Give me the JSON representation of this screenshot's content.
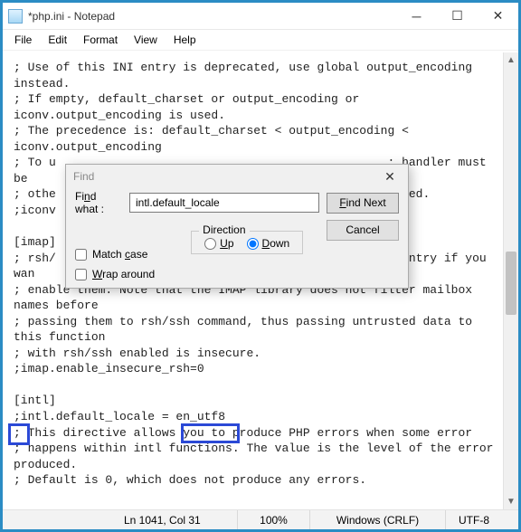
{
  "window": {
    "title": "*php.ini - Notepad"
  },
  "menu": {
    "file": "File",
    "edit": "Edit",
    "format": "Format",
    "view": "View",
    "help": "Help"
  },
  "editor": {
    "text": "; Use of this INI entry is deprecated, use global output_encoding instead.\n; If empty, default_charset or output_encoding or iconv.output_encoding is used.\n; The precedence is: default_charset < output_encoding < iconv.output_encoding\n; To u                                               : handler must be\n; othe                                               ormed.\n;iconv\n\n[imap]\n; rsh/                                               : entry if you wan\n; enable them. Note that the IMAP library does not filter mailbox names before\n; passing them to rsh/ssh command, thus passing untrusted data to this function\n; with rsh/ssh enabled is insecure.\n;imap.enable_insecure_rsh=0\n\n[intl]\n;intl.default_locale = en_utf8\n; This directive allows you to produce PHP errors when some error\n; happens within intl functions. The value is the level of the error produced.\n; Default is 0, which does not produce any errors."
  },
  "find": {
    "title": "Find",
    "label_find_what": "Find what :",
    "input_value": "intl.default_locale",
    "btn_find_next": "Find Next",
    "btn_cancel": "Cancel",
    "direction_legend": "Direction",
    "radio_up": "Up",
    "radio_down": "Down",
    "chk_match_case": "Match case",
    "chk_wrap_around": "Wrap around"
  },
  "status": {
    "position": "Ln 1041, Col 31",
    "zoom": "100%",
    "line_ending": "Windows (CRLF)",
    "encoding": "UTF-8"
  }
}
